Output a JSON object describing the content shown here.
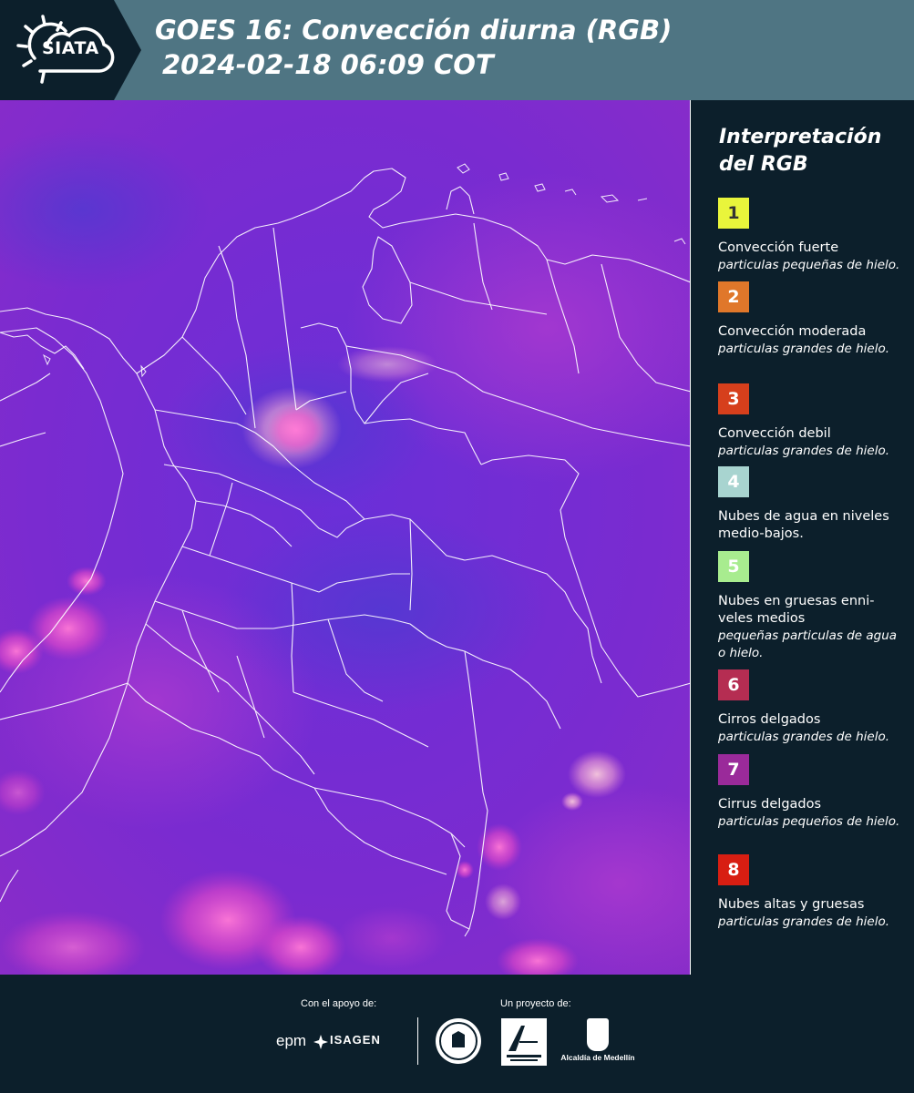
{
  "header": {
    "logo_text": "SIATA",
    "title_line1": "GOES 16: Convección diurna (RGB)",
    "title_line2": "2024-02-18 06:09 COT"
  },
  "map": {
    "description_colors": {
      "base": "#7a2bd6",
      "pink": "#ff5fc8",
      "light": "#f2b9d9"
    }
  },
  "legend": {
    "title": "Interpretación del RGB",
    "items": [
      {
        "number": "1",
        "color": "#e9f53b",
        "text_color": "#333333",
        "label": "Convección fuerte",
        "sub": "particulas pequeñas de hielo."
      },
      {
        "number": "2",
        "color": "#e0772a",
        "text_color": "#ffffff",
        "label": "Convección moderada",
        "sub": "particulas grandes de hielo."
      },
      {
        "number": "3",
        "color": "#d63f1c",
        "text_color": "#ffffff",
        "label": "Convección debil",
        "sub": "particulas grandes de hielo."
      },
      {
        "number": "4",
        "color": "#a8d4d0",
        "text_color": "#ffffff",
        "label": "Nubes de agua en niveles medio-bajos.",
        "sub": ""
      },
      {
        "number": "5",
        "color": "#a8ec8f",
        "text_color": "#ffffff",
        "label": "Nubes en gruesas enni-veles medios",
        "sub": "pequeñas particulas de agua o hielo."
      },
      {
        "number": "6",
        "color": "#b52d52",
        "text_color": "#ffffff",
        "label": "Cirros delgados",
        "sub": "particulas grandes de hielo."
      },
      {
        "number": "7",
        "color": "#9a2a9a",
        "text_color": "#ffffff",
        "label": "Cirrus delgados",
        "sub": "particulas pequeños de hielo."
      },
      {
        "number": "8",
        "color": "#d81e12",
        "text_color": "#ffffff",
        "label": "Nubes altas y gruesas",
        "sub": "particulas grandes de hielo."
      }
    ]
  },
  "footer": {
    "support_label": "Con el apoyo de:",
    "project_label": "Un proyecto de:",
    "epm": "epm",
    "isagen": "ISAGEN",
    "alcaldia": "Alcaldía de Medellín"
  }
}
